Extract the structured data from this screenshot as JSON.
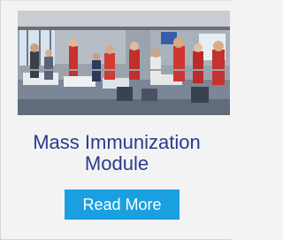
{
  "card": {
    "title_line1": "Mass Immunization",
    "title_line2": "Module",
    "button_label": "Read More"
  },
  "colors": {
    "title": "#2b3a8e",
    "button_bg": "#1aa0e0",
    "button_text": "#ffffff",
    "page_bg": "#f3f3f3"
  }
}
